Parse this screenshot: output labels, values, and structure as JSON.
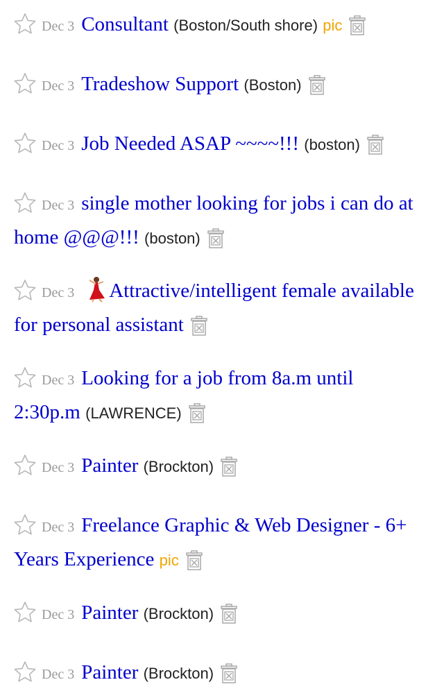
{
  "watermark": "craigslist",
  "colors": {
    "title_link": "#0000cc",
    "date": "#9a9a9a",
    "pic_tag": "#f0a500",
    "star_outline": "#b8b8b8",
    "trash_outline": "#a8a8a8",
    "watermark": "#f3f1f8"
  },
  "listings": [
    {
      "date": "Dec 3",
      "title": "Consultant",
      "hood": "(Boston/South shore)",
      "pic": "pic"
    },
    {
      "date": "Dec 3",
      "title": "Tradeshow Support",
      "hood": "(Boston)",
      "pic": ""
    },
    {
      "date": "Dec 3",
      "title": "Job Needed ASAP ~~~~!!!",
      "hood": "(boston)",
      "pic": ""
    },
    {
      "date": "Dec 3",
      "title": "single mother looking for jobs i can do at home @@@!!!",
      "hood": "(boston)",
      "pic": ""
    },
    {
      "date": "Dec 3",
      "title": "Attractive/intelligent female available for personal assistant",
      "hood": "",
      "pic": "",
      "emoji": "dancer-emoji"
    },
    {
      "date": "Dec 3",
      "title": "Looking for a job from 8a.m until 2:30p.m",
      "hood": "(LAWRENCE)",
      "pic": ""
    },
    {
      "date": "Dec 3",
      "title": "Painter",
      "hood": "(Brockton)",
      "pic": ""
    },
    {
      "date": "Dec 3",
      "title": "Freelance Graphic & Web Designer - 6+ Years Experience",
      "hood": "",
      "pic": "pic"
    },
    {
      "date": "Dec 3",
      "title": "Painter",
      "hood": "(Brockton)",
      "pic": ""
    },
    {
      "date": "Dec 3",
      "title": "Painter",
      "hood": "(Brockton)",
      "pic": ""
    }
  ]
}
